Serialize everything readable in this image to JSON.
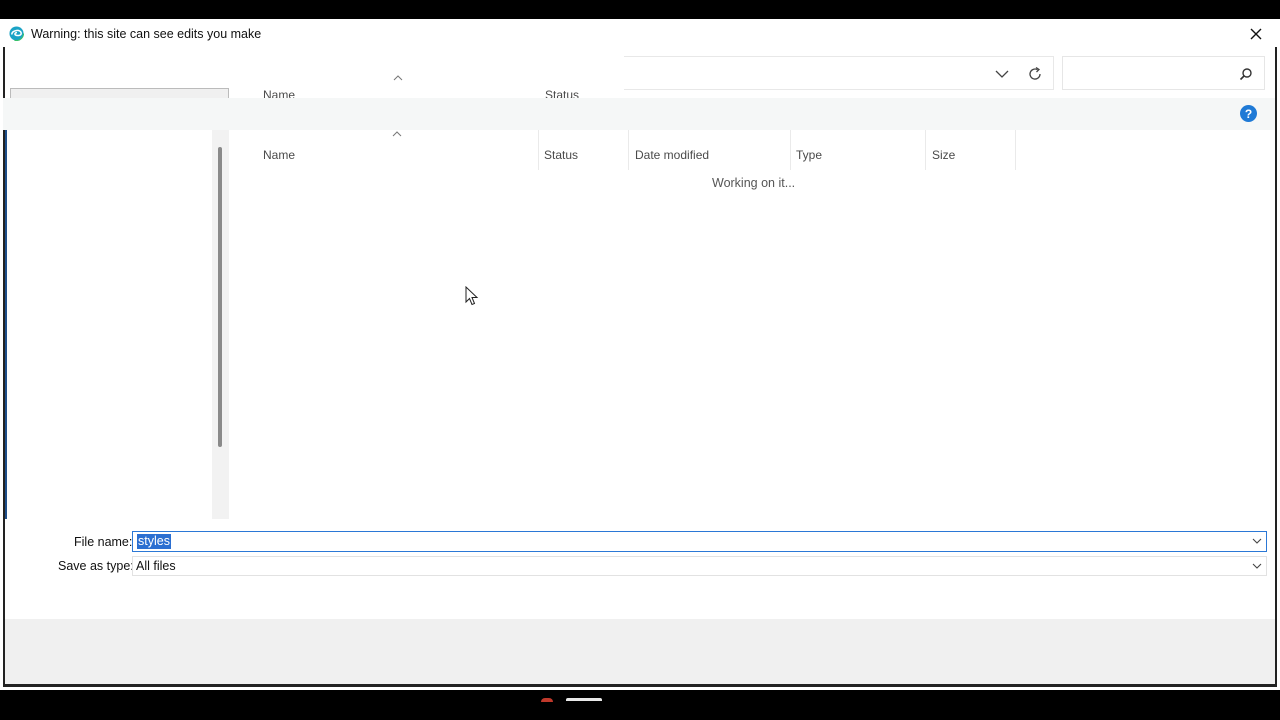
{
  "titlebar": {
    "title": "Warning: this site can see edits you make",
    "browser_icon": "edge-icon",
    "close_icon": "close-icon"
  },
  "address": {
    "dropdown_icon": "chevron-down-icon",
    "refresh_icon": "refresh-icon",
    "search_icon": "search-icon",
    "search_placeholder": ""
  },
  "ghost_header": {
    "name": "Name",
    "status": "Status"
  },
  "help": {
    "label": "?"
  },
  "filelist": {
    "columns": [
      "Name",
      "Status",
      "Date modified",
      "Type",
      "Size"
    ],
    "message": "Working on it..."
  },
  "save": {
    "filename_label": "File name:",
    "filename_value": "styles",
    "savetype_label": "Save as type:",
    "savetype_value": "All files"
  },
  "colors": {
    "accent": "#2b6fd1",
    "help_blue": "#1f7ad6",
    "edge_teal": "#1ba3c6"
  }
}
